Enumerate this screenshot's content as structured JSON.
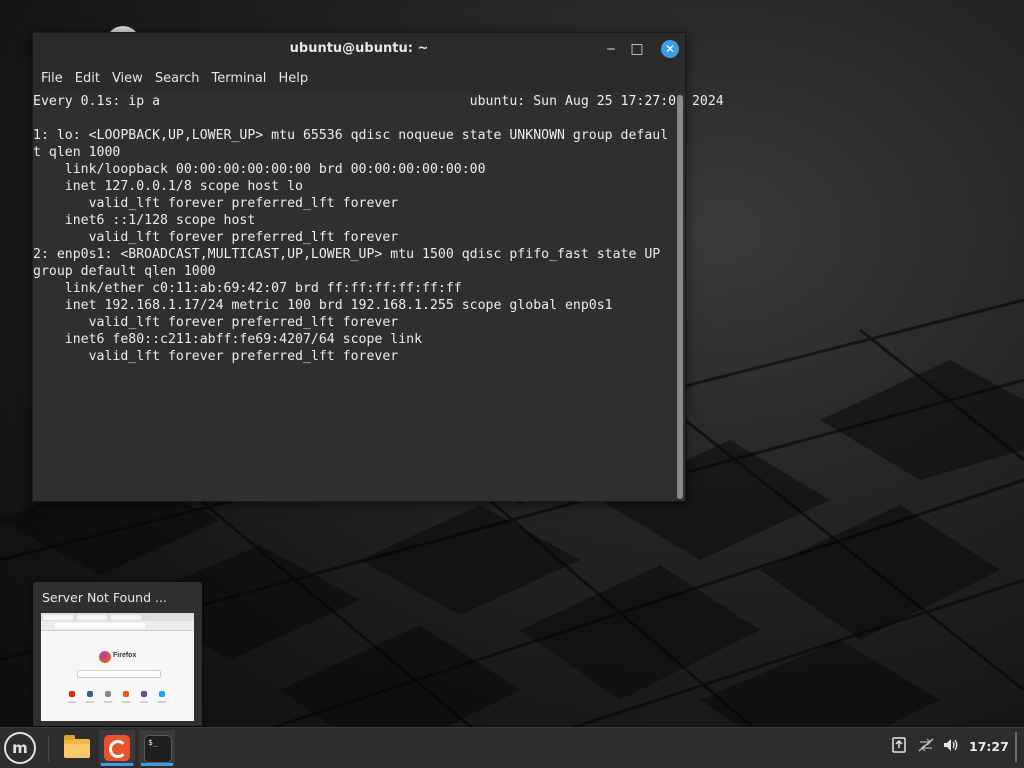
{
  "terminal": {
    "title": "ubuntu@ubuntu: ~",
    "menu": [
      "File",
      "Edit",
      "View",
      "Search",
      "Terminal",
      "Help"
    ],
    "lines": [
      "Every 0.1s: ip a                                       ubuntu: Sun Aug 25 17:27:01 2024",
      "",
      "1: lo: <LOOPBACK,UP,LOWER_UP> mtu 65536 qdisc noqueue state UNKNOWN group defaul",
      "t qlen 1000",
      "    link/loopback 00:00:00:00:00:00 brd 00:00:00:00:00:00",
      "    inet 127.0.0.1/8 scope host lo",
      "       valid_lft forever preferred_lft forever",
      "    inet6 ::1/128 scope host",
      "       valid_lft forever preferred_lft forever",
      "2: enp0s1: <BROADCAST,MULTICAST,UP,LOWER_UP> mtu 1500 qdisc pfifo_fast state UP",
      "group default qlen 1000",
      "    link/ether c0:11:ab:69:42:07 brd ff:ff:ff:ff:ff:ff",
      "    inet 192.168.1.17/24 metric 100 brd 192.168.1.255 scope global enp0s1",
      "       valid_lft forever preferred_lft forever",
      "    inet6 fe80::c211:abff:fe69:4207/64 scope link",
      "       valid_lft forever preferred_lft forever"
    ]
  },
  "window_preview": {
    "title": "Server Not Found ...",
    "thumbnail_brand": "Firefox"
  },
  "taskbar": {
    "clock": "17:27",
    "apps": [
      {
        "name": "files",
        "icon": "folder-icon"
      },
      {
        "name": "firefox",
        "icon": "firefox-icon"
      },
      {
        "name": "terminal",
        "icon": "terminal-icon"
      }
    ],
    "tray_icons": [
      "update-manager-icon",
      "network-icon",
      "volume-icon"
    ]
  },
  "colors": {
    "accent": "#3d9ee8",
    "terminal_bg": "#2f2f2f",
    "panel_bg": "#2d2d2d",
    "terminal_text": "#ececec"
  }
}
